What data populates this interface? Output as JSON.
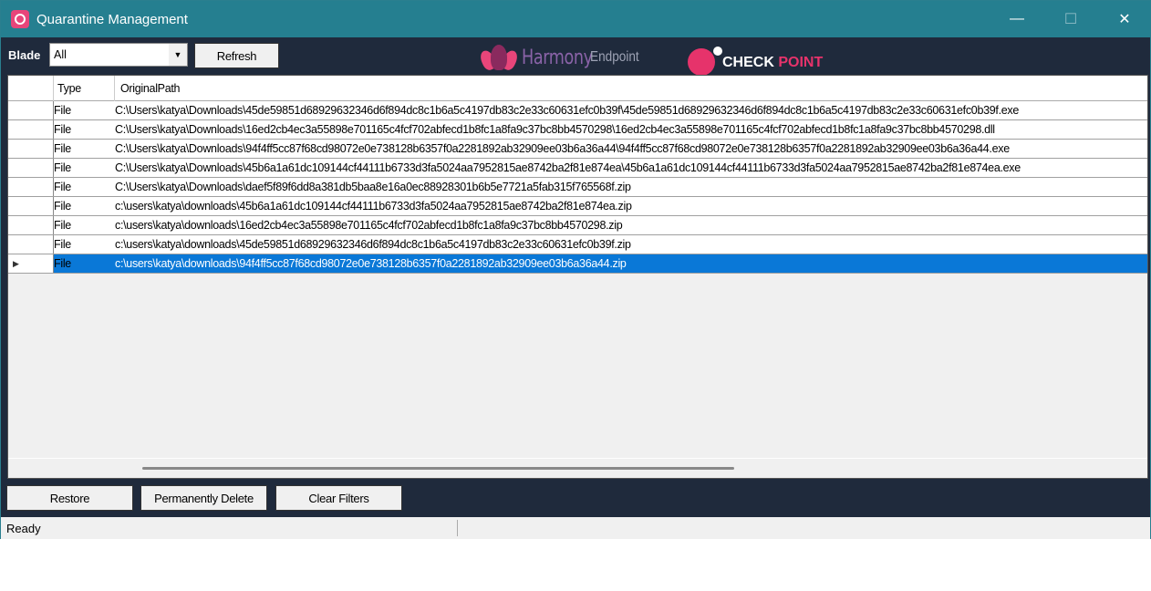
{
  "window": {
    "title": "Quarantine Management",
    "minimize": "—",
    "maximize": "☐",
    "close": "✕"
  },
  "toolbar": {
    "blade_label": "Blade",
    "blade_value": "All",
    "refresh_label": "Refresh"
  },
  "branding": {
    "harmony": "Harmony",
    "endpoint": "Endpoint",
    "checkpoint_a": "CHECK ",
    "checkpoint_b": "POINT"
  },
  "grid": {
    "columns": [
      "Type",
      "OriginalPath"
    ],
    "rows": [
      {
        "type": "File",
        "path": "C:\\Users\\katya\\Downloads\\45de59851d68929632346d6f894dc8c1b6a5c4197db83c2e33c60631efc0b39f\\45de59851d68929632346d6f894dc8c1b6a5c4197db83c2e33c60631efc0b39f.exe"
      },
      {
        "type": "File",
        "path": "C:\\Users\\katya\\Downloads\\16ed2cb4ec3a55898e701165c4fcf702abfecd1b8fc1a8fa9c37bc8bb4570298\\16ed2cb4ec3a55898e701165c4fcf702abfecd1b8fc1a8fa9c37bc8bb4570298.dll"
      },
      {
        "type": "File",
        "path": "C:\\Users\\katya\\Downloads\\94f4ff5cc87f68cd98072e0e738128b6357f0a2281892ab32909ee03b6a36a44\\94f4ff5cc87f68cd98072e0e738128b6357f0a2281892ab32909ee03b6a36a44.exe"
      },
      {
        "type": "File",
        "path": "C:\\Users\\katya\\Downloads\\45b6a1a61dc109144cf44111b6733d3fa5024aa7952815ae8742ba2f81e874ea\\45b6a1a61dc109144cf44111b6733d3fa5024aa7952815ae8742ba2f81e874ea.exe"
      },
      {
        "type": "File",
        "path": "C:\\Users\\katya\\Downloads\\daef5f89f6dd8a381db5baa8e16a0ec88928301b6b5e7721a5fab315f765568f.zip"
      },
      {
        "type": "File",
        "path": "c:\\users\\katya\\downloads\\45b6a1a61dc109144cf44111b6733d3fa5024aa7952815ae8742ba2f81e874ea.zip"
      },
      {
        "type": "File",
        "path": "c:\\users\\katya\\downloads\\16ed2cb4ec3a55898e701165c4fcf702abfecd1b8fc1a8fa9c37bc8bb4570298.zip"
      },
      {
        "type": "File",
        "path": "c:\\users\\katya\\downloads\\45de59851d68929632346d6f894dc8c1b6a5c4197db83c2e33c60631efc0b39f.zip"
      },
      {
        "type": "File",
        "path": "c:\\users\\katya\\downloads\\94f4ff5cc87f68cd98072e0e738128b6357f0a2281892ab32909ee03b6a36a44.zip"
      }
    ],
    "selected_row": 8,
    "row_pointer": "▶"
  },
  "actions": {
    "restore": "Restore",
    "delete": "Permanently Delete",
    "clear": "Clear Filters"
  },
  "status": {
    "text": "Ready"
  },
  "colors": {
    "titlebar": "#257f90",
    "body": "#1f2a3c",
    "selection": "#0a78d7",
    "brand_pink": "#e6336b"
  }
}
